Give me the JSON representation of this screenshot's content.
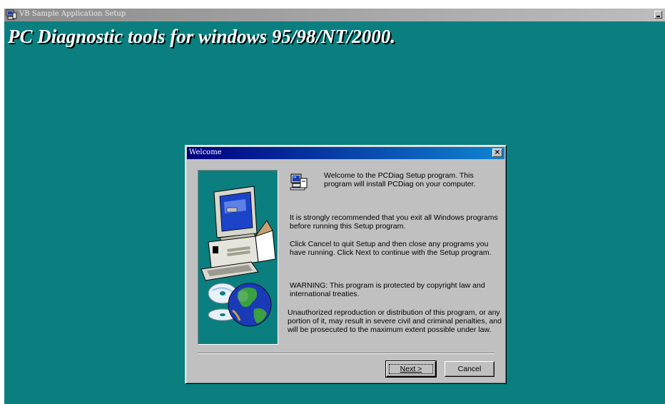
{
  "window": {
    "title": "VB Sample Application Setup",
    "banner": "PC Diagnostic tools for windows 95/98/NT/2000."
  },
  "dialog": {
    "title": "Welcome",
    "close_glyph": "×",
    "welcome_text": "Welcome to the PCDiag Setup program.  This\nprogram will install PCDiag on your computer.",
    "recommend_text": "It is strongly recommended that you exit all Windows programs\nbefore running this Setup program.",
    "cancel_info_text": "Click Cancel to quit Setup and then close any programs you\nhave running.  Click Next to continue with the Setup program.",
    "warning_text": "WARNING: This program is protected by copyright law and\ninternational treaties.",
    "unauthorized_text": "Unauthorized reproduction or distribution of this program, or any\nportion of it, may result in severe civil and criminal penalties, and\nwill be prosecuted to the maximum extent possible under law.",
    "buttons": {
      "next": "Next >",
      "cancel": "Cancel"
    }
  },
  "icons": {
    "title_icon": "setup-computer-icon",
    "dialog_icon": "setup-computer-icon",
    "panel_art": "computer-and-globe-illustration"
  },
  "colors": {
    "desktop_teal": "#0b7f7f",
    "dialog_face": "#c0c0c0",
    "title_active_start": "#000080",
    "title_active_end": "#1084d0",
    "title_inactive_start": "#8c8c8c",
    "title_inactive_end": "#bdbdbd"
  }
}
